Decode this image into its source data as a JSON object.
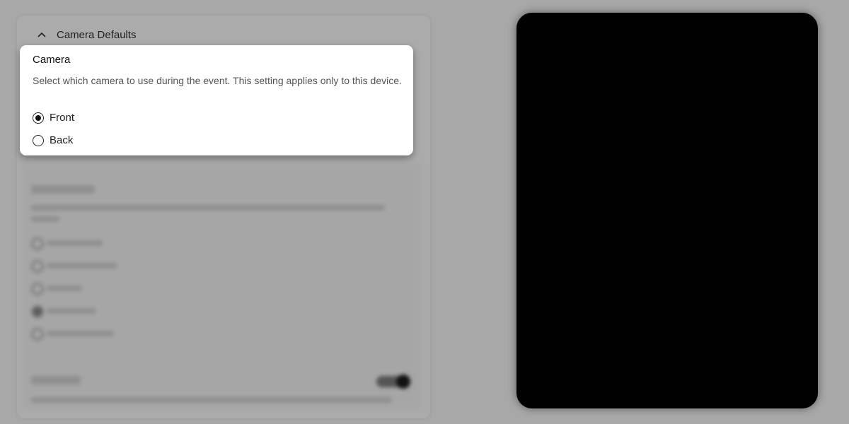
{
  "section": {
    "title": "Camera Defaults",
    "collapse_icon": "chevron-up-icon"
  },
  "camera_card": {
    "title": "Camera",
    "description": "Select which camera to use during the event. This setting applies only to this device.",
    "options": [
      {
        "label": "Front",
        "selected": true
      },
      {
        "label": "Back",
        "selected": false
      }
    ]
  },
  "preview": {
    "icon": "camera-preview"
  }
}
